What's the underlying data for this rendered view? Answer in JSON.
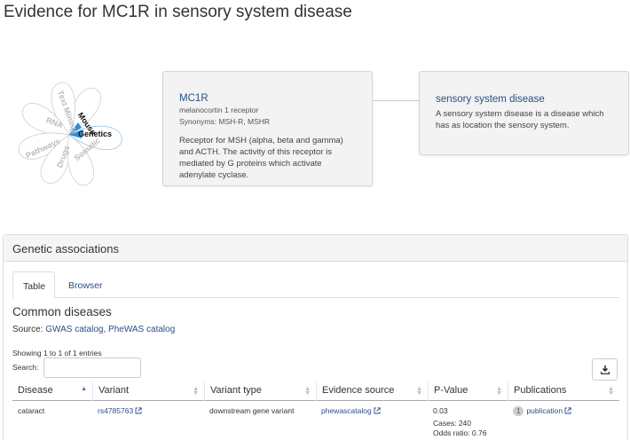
{
  "page": {
    "title": "Evidence for MC1R in sensory system disease"
  },
  "flower": {
    "petals": [
      "Genetics",
      "Mouse",
      "Text Mining",
      "RNA",
      "Pathways",
      "Drugs",
      "Somatic"
    ],
    "active_color": "#2a8fd6"
  },
  "target_card": {
    "symbol": "MC1R",
    "name": "melanocortin 1 receptor",
    "synonyms": "Synonyms: MSH-R, MSHR",
    "description": "Receptor for MSH (alpha, beta and gamma) and ACTH. The activity of this receptor is mediated by G proteins which activate adenylate cyclase."
  },
  "disease_card": {
    "name": "sensory system disease",
    "description": "A sensory system disease is a disease which has as location the sensory system."
  },
  "panel": {
    "heading": "Genetic associations",
    "tabs": [
      {
        "label": "Table"
      },
      {
        "label": "Browser"
      }
    ],
    "section_title": "Common diseases",
    "source_prefix": "Source: ",
    "source_link_1": "GWAS catalog",
    "source_sep": ", ",
    "source_link_2": "PheWAS catalog",
    "showing": "Showing 1 to 1 of 1 entries",
    "search_label": "Search:",
    "search_value": "",
    "columns": [
      "Disease",
      "Variant",
      "Variant type",
      "Evidence source",
      "P-Value",
      "Publications"
    ],
    "rows": [
      {
        "disease": "cataract",
        "variant": "rs4785763",
        "variant_type": "downstream gene variant",
        "evidence_source": "phewascatalog",
        "p_value": "0.03",
        "cases": "Cases: 240",
        "odds_ratio": "Odds ratio: 0.76",
        "pub_count": "1",
        "pub_label": "publication"
      }
    ]
  },
  "colors": {
    "link": "#2a4f86",
    "card_bg": "#f3f3f3"
  }
}
